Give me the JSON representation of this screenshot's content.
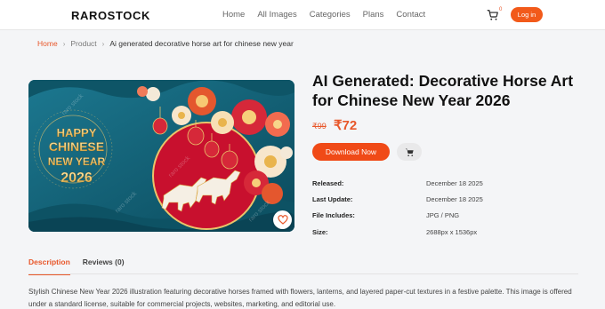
{
  "header": {
    "logo": "RAROSTOCK",
    "nav": [
      "Home",
      "All Images",
      "Categories",
      "Plans",
      "Contact"
    ],
    "cart_count": "0",
    "login_label": "Log in"
  },
  "breadcrumb": {
    "home": "Home",
    "parent": "Product",
    "current": "Ai generated decorative horse art for chinese new year"
  },
  "image": {
    "line1": "HAPPY",
    "line2": "CHINESE",
    "line3": "NEW YEAR",
    "line4": "2026",
    "watermark": "raro stock"
  },
  "product": {
    "title": "AI Generated: Decorative Horse Art for Chinese New Year 2026",
    "old_price": "₹99",
    "price": "₹72",
    "download_label": "Download Now",
    "specs": [
      {
        "label": "Released:",
        "value": "December 18 2025"
      },
      {
        "label": "Last Update:",
        "value": "December 18 2025"
      },
      {
        "label": "File Includes:",
        "value": "JPG / PNG"
      },
      {
        "label": "Size:",
        "value": "2688px x 1536px"
      }
    ]
  },
  "tabs": {
    "description": "Description",
    "reviews": "Reviews (0)"
  },
  "description": "Stylish Chinese New Year 2026 illustration featuring decorative horses framed with flowers, lanterns, and layered paper-cut textures in a festive palette. This image is offered under a standard license, suitable for commercial projects, websites, marketing, and editorial use.",
  "icons": {
    "cart": "cart-icon",
    "favorite": "heart-icon",
    "add_to_cart": "cart-icon"
  },
  "colors": {
    "accent": "#f04a17",
    "hero_bg": "#0f5f73",
    "hero_red": "#c8102e",
    "gold": "#e9c46a"
  }
}
